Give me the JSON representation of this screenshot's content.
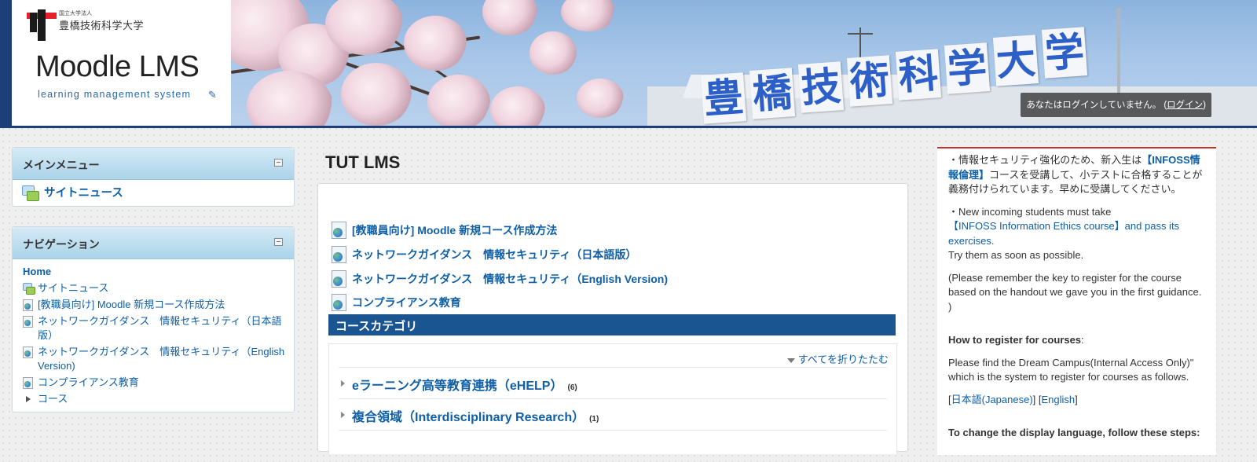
{
  "header": {
    "univ_small": "国立大学法人",
    "univ_name": "豊橋技術科学大学",
    "lms_title": "Moodle LMS",
    "lms_subtitle": "learning management system",
    "sign_chars": [
      "豊",
      "橋",
      "技",
      "術",
      "科",
      "学",
      "大",
      "学"
    ],
    "login_text": "あなたはログインしていません。 (",
    "login_link": "ログイン",
    "login_close": ")"
  },
  "main_menu": {
    "title": "メインメニュー",
    "site_news": "サイトニュース"
  },
  "navigation": {
    "title": "ナビゲーション",
    "home": "Home",
    "items": [
      {
        "label": "サイトニュース",
        "icon": "forum-icon"
      },
      {
        "label": "[教職員向け] Moodle 新規コース作成方法",
        "icon": "page-icon"
      },
      {
        "label": "ネットワークガイダンス　情報セキュリティ（日本語版）",
        "icon": "page-icon"
      },
      {
        "label": "ネットワークガイダンス　情報セキュリティ（English Version)",
        "icon": "page-icon"
      },
      {
        "label": "コンプライアンス教育",
        "icon": "page-icon"
      }
    ],
    "courses": "コース"
  },
  "main": {
    "heading": "TUT LMS",
    "course_links": [
      "[教職員向け] Moodle 新規コース作成方法",
      "ネットワークガイダンス　情報セキュリティ（日本語版）",
      "ネットワークガイダンス　情報セキュリティ（English Version)",
      "コンプライアンス教育"
    ],
    "category_title": "コースカテゴリ",
    "collapse_all": "すべてを折りたたむ",
    "categories": [
      {
        "name": "eラーニング高等教育連携（eHELP）",
        "count": "(6)"
      },
      {
        "name": "複合領域（Interdisciplinary Research）",
        "count": "(1)"
      }
    ]
  },
  "right": {
    "p1_a": "・情報セキュリティ強化のため、新入生は",
    "p1_link": "【INFOSS情報倫理】",
    "p1_b": "コースを受講して、小テストに合格することが義務付けられています。早めに受講してください。",
    "p2_a": "・New incoming students must take",
    "p2_link": "【INFOSS Information Ethics course】and pass its exercises.",
    "p2_b": "Try them as soon as possible.",
    "p3": "(Please remember the key to register for the course based on the handout we gave you in the first guidance. )",
    "p4_head": "How to register for courses",
    "p4_colon": ":",
    "p5": "Please find the Dream Campus(Internal Access Only)\" which is the system to register for courses as follows.",
    "lang_open": "[",
    "lang_ja": "日本語(Japanese)",
    "lang_mid": "] [",
    "lang_en": "English",
    "lang_close": "]",
    "p6_head": "To change the display language, follow these steps:"
  }
}
